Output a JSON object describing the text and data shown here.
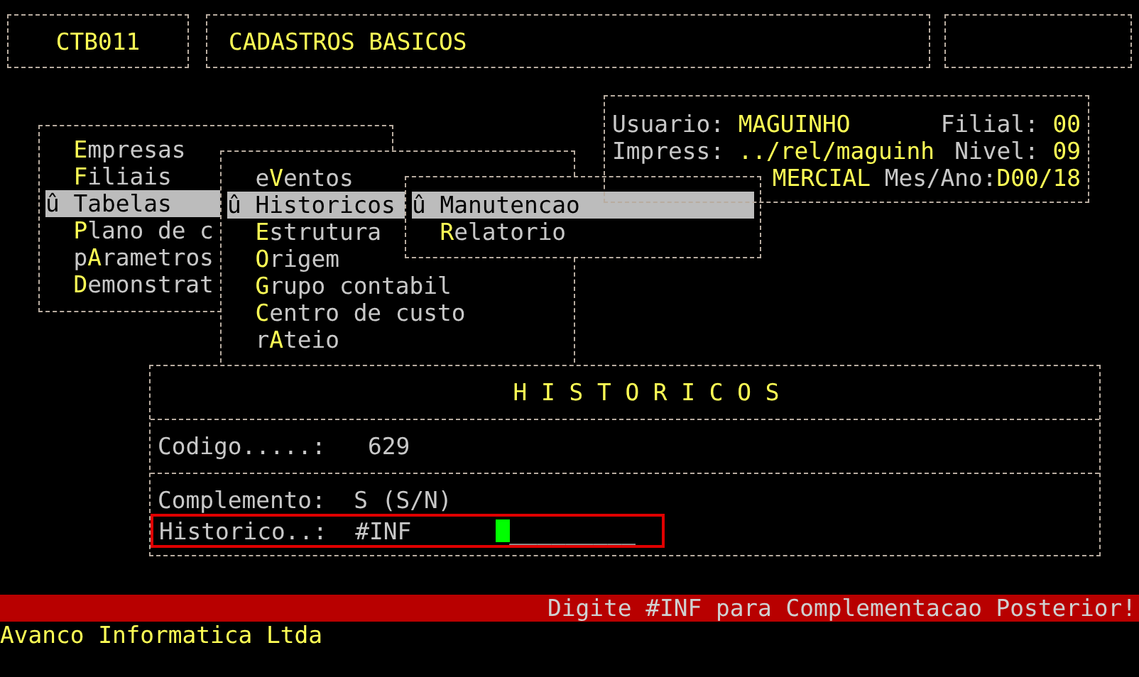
{
  "header": {
    "program_code": "CTB011",
    "title": "CADASTROS BASICOS"
  },
  "menus": [
    {
      "items": [
        {
          "label": "**E**mpresas",
          "selected": false
        },
        {
          "label": "**F**iliais",
          "selected": false
        },
        {
          "label": "Tabelas",
          "marker": "û",
          "selected": true
        },
        {
          "label": "**P**lano de c",
          "selected": false
        },
        {
          "label": "p**A**rametros",
          "selected": false
        },
        {
          "label": "**D**emonstrat",
          "selected": false
        }
      ]
    },
    {
      "items": [
        {
          "label": "e**V**entos",
          "selected": false
        },
        {
          "label": "Historicos",
          "marker": "û",
          "selected": true
        },
        {
          "label": "**E**strutura",
          "selected": false
        },
        {
          "label": "**O**rigem",
          "selected": false
        },
        {
          "label": "**G**rupo contabil",
          "selected": false
        },
        {
          "label": "**C**entro de custo",
          "selected": false
        },
        {
          "label": "r**A**teio",
          "selected": false
        }
      ]
    },
    {
      "items": [
        {
          "label": "Manutencao",
          "marker": "û",
          "selected": true
        },
        {
          "label": "**R**elatorio",
          "selected": false
        }
      ]
    }
  ],
  "info": {
    "lines": [
      {
        "left": [
          {
            "text": "Usuario:",
            "kind": "label"
          },
          {
            "text": "MAGUINHO",
            "kind": "value"
          }
        ],
        "right": [
          {
            "text": "Filial:",
            "kind": "label"
          },
          {
            "text": "00",
            "kind": "value"
          }
        ]
      },
      {
        "left": [
          {
            "text": "Impress:",
            "kind": "label"
          },
          {
            "text": "../rel/maguinh",
            "kind": "value"
          }
        ],
        "right": [
          {
            "text": "Nivel:",
            "kind": "label"
          },
          {
            "text": "09",
            "kind": "value"
          }
        ]
      },
      {
        "right": [
          {
            "text": "MERCIAL",
            "kind": "value"
          },
          {
            "text": "Mes/Ano:",
            "kind": "label",
            "tight": true
          },
          {
            "text": "D00/18",
            "kind": "value"
          }
        ]
      }
    ]
  },
  "form": {
    "title": "H I S T O R I C O S",
    "sections": [
      {
        "fields": [
          {
            "kind": "display",
            "label": "Codigo.....:",
            "value": "629"
          }
        ]
      },
      {
        "fields": [
          {
            "kind": "choice",
            "label": "Complemento:",
            "value": "S",
            "hint": "(S/N)"
          },
          {
            "kind": "input",
            "label": "Historico..:",
            "value": "#INF",
            "mask": "_________",
            "focused": true
          }
        ]
      }
    ]
  },
  "status_message": "Digite #INF para Complementacao Posterior!",
  "footer": "Avanco Informatica Ltda"
}
